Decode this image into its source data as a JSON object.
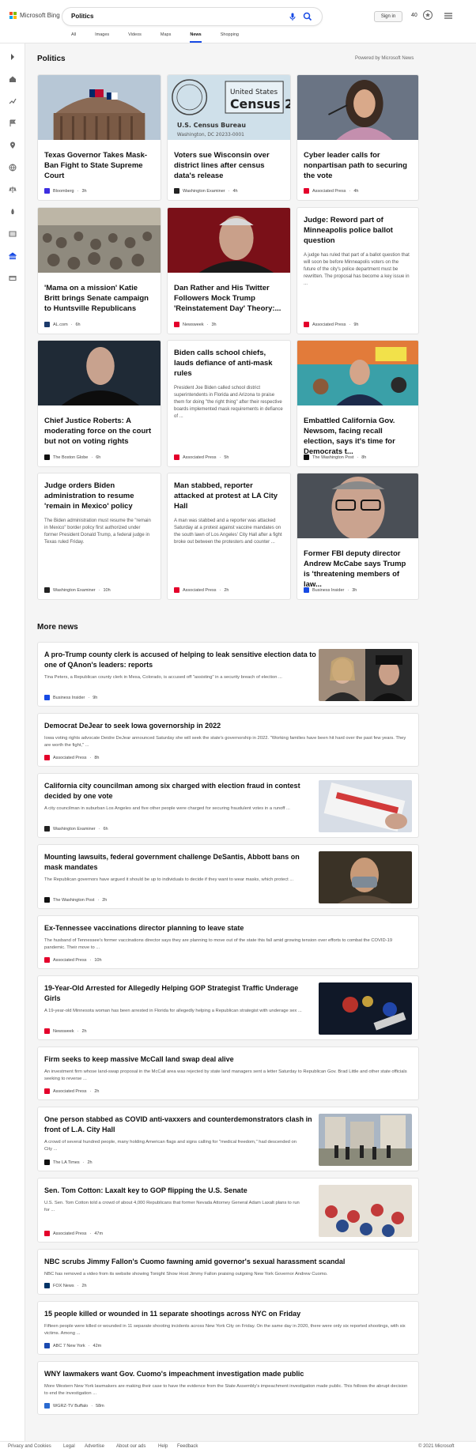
{
  "header": {
    "logo_text": "Microsoft Bing",
    "query": "Politics",
    "signin": "Sign in",
    "points": "40",
    "tabs": [
      "All",
      "Images",
      "Videos",
      "Maps",
      "News",
      "Shopping"
    ],
    "active_tab": "News"
  },
  "politics": {
    "title": "Politics",
    "powered": "Powered by Microsoft News",
    "cards": [
      {
        "title": "Texas Governor Takes Mask-Ban Fight to State Supreme Court",
        "source": "Bloomberg",
        "age": "3h"
      },
      {
        "title": "Voters sue Wisconsin over district lines after census data's release",
        "source": "Washington Examiner",
        "age": "4h"
      },
      {
        "title": "Cyber leader calls for nonpartisan path to securing the vote",
        "source": "Associated Press",
        "age": "4h"
      },
      {
        "title": "'Mama on a mission' Katie Britt brings Senate campaign to Huntsville Republicans",
        "source": "AL.com",
        "age": "6h"
      },
      {
        "title": "Dan Rather and His Twitter Followers Mock Trump 'Reinstatement Day' Theory:...",
        "source": "Newsweek",
        "age": "3h"
      },
      {
        "title": "Judge: Reword part of Minneapolis police ballot question",
        "snippet": "A judge has ruled that part of a ballot question that will soon be before Minneapolis voters on the future of the city's police department must be rewritten. The proposal has become a key issue in ...",
        "source": "Associated Press",
        "age": "9h"
      },
      {
        "title": "Chief Justice Roberts: A moderating force on the court but not on voting rights",
        "source": "The Boston Globe",
        "age": "6h"
      },
      {
        "title": "Biden calls school chiefs, lauds defiance of anti-mask rules",
        "snippet": "President Joe Biden called school district superintendents in Florida and Arizona to praise them for doing \"the right thing\" after their respective boards implemented mask requirements in defiance of ...",
        "source": "Associated Press",
        "age": "5h"
      },
      {
        "title": "Embattled California Gov. Newsom, facing recall election, says it's time for Democrats t...",
        "source": "The Washington Post",
        "age": "8h"
      },
      {
        "title": "Judge orders Biden administration to resume 'remain in Mexico' policy",
        "snippet": "The Biden administration must resume the \"remain in Mexico\" border policy first authorized under former President Donald Trump, a federal judge in Texas ruled Friday.",
        "source": "Washington Examiner",
        "age": "10h"
      },
      {
        "title": "Man stabbed, reporter attacked at protest at LA City Hall",
        "snippet": "A man was stabbed and a reporter was attacked Saturday at a protest against vaccine mandates on the south lawn of Los Angeles' City Hall after a fight broke out between the protesters and counter ...",
        "source": "Associated Press",
        "age": "2h"
      },
      {
        "title": "Former FBI deputy director Andrew McCabe says Trump is 'threatening members of law...",
        "source": "Business Insider",
        "age": "3h"
      }
    ]
  },
  "more_news": {
    "title": "More news",
    "items": [
      {
        "title": "A pro-Trump county clerk is accused of helping to leak sensitive election data to one of QAnon's leaders: reports",
        "snippet": "Tina Peters, a Republican county clerk in Mesa, Colorado, is accused off \"assisting\" in a security breach of election ...",
        "source": "Business Insider",
        "age": "9h"
      },
      {
        "title": "Democrat DeJear to seek Iowa governorship in 2022",
        "snippet": "Iowa voting rights advocate Deidre DeJear announced Saturday she will seek the state's governorship in 2022. \"Working families have been hit hard over the past few years. They are worth the fight,\" ...",
        "source": "Associated Press",
        "age": "8h"
      },
      {
        "title": "California city councilman among six charged with election fraud in contest decided by one vote",
        "snippet": "A city councilman in suburban Los Angeles and five other people were charged for securing fraudulent votes in a runoff ...",
        "source": "Washington Examiner",
        "age": "6h"
      },
      {
        "title": "Mounting lawsuits, federal government challenge DeSantis, Abbott bans on mask mandates",
        "snippet": "The Republican governors have argued it should be up to individuals to decide if they want to wear masks, which protect ...",
        "source": "The Washington Post",
        "age": "2h"
      },
      {
        "title": "Ex-Tennessee vaccinations director planning to leave state",
        "snippet": "The husband of Tennessee's former vaccinations director says they are planning to move out of the state this fall amid growing tension over efforts to combat the COVID-19 pandemic. Their move to ...",
        "source": "Associated Press",
        "age": "10h"
      },
      {
        "title": "19-Year-Old Arrested for Allegedly Helping GOP Strategist Traffic Underage Girls",
        "snippet": "A 19-year-old Minnesota woman has been arrested in Florida for allegedly helping a Republican strategist with underage sex ...",
        "source": "Newsweek",
        "age": "2h"
      },
      {
        "title": "Firm seeks to keep massive McCall land swap deal alive",
        "snippet": "An investment firm whose land-swap proposal in the McCall area was rejected by state land managers sent a letter Saturday to Republican Gov. Brad Little and other state officials seeking to reverse ...",
        "source": "Associated Press",
        "age": "2h"
      },
      {
        "title": "One person stabbed as COVID anti-vaxxers and counterdemonstrators clash in front of L.A. City Hall",
        "snippet": "A crowd of several hundred people, many holding American flags and signs calling for \"medical freedom,\" had descended on City ...",
        "source": "The LA Times",
        "age": "2h"
      },
      {
        "title": "Sen. Tom Cotton: Laxalt key to GOP flipping the U.S. Senate",
        "snippet": "U.S. Sen. Tom Cotton told a crowd of about 4,000 Republicans that former Nevada Attorney General Adam Laxalt plans to run for ...",
        "source": "Associated Press",
        "age": "47m"
      },
      {
        "title": "NBC scrubs Jimmy Fallon's Cuomo fawning amid governor's sexual harassment scandal",
        "snippet": "NBC has removed a video from its website showing Tonight Show Host Jimmy Fallon praising outgoing New York Governor Andrew Cuomo.",
        "source": "FOX News",
        "age": "2h"
      },
      {
        "title": "15 people killed or wounded in 11 separate shootings across NYC on Friday",
        "snippet": "Fifteen people were killed or wounded in 11 separate shooting incidents across New York City on Friday. On the same day in 2020, there were only six reported shootings, with six victims. Among ...",
        "source": "ABC 7 New York",
        "age": "42m"
      },
      {
        "title": "WNY lawmakers want Gov. Cuomo's impeachment investigation made public",
        "snippet": "More Western New York lawmakers are making their case to have the evidence from the State Assembly's impeachment investigation made public. This follows the abrupt decision to end the investigation ...",
        "source": "WGRZ-TV Buffalo",
        "age": "58m"
      }
    ]
  },
  "footer": {
    "links": [
      "Privacy and Cookies",
      "Legal",
      "Advertise",
      "About our ads",
      "Help",
      "Feedback"
    ],
    "copyright": "© 2021 Microsoft"
  },
  "colors": {
    "accent": "#174ae4",
    "ap_red": "#e4002b",
    "newsweek_red": "#e4002b"
  }
}
